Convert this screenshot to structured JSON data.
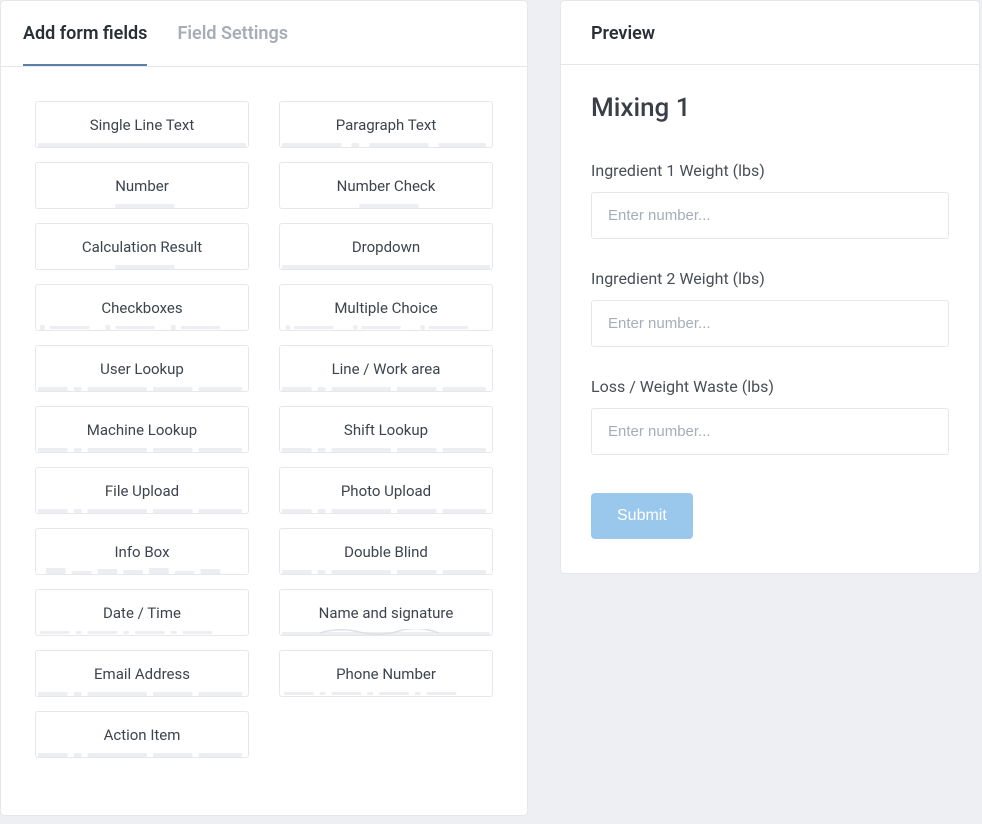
{
  "tabs": {
    "add_fields": "Add form fields",
    "field_settings": "Field Settings"
  },
  "fields": {
    "single_line_text": "Single Line Text",
    "paragraph_text": "Paragraph Text",
    "number": "Number",
    "number_check": "Number Check",
    "calculation_result": "Calculation Result",
    "dropdown": "Dropdown",
    "checkboxes": "Checkboxes",
    "multiple_choice": "Multiple Choice",
    "user_lookup": "User Lookup",
    "line_work_area": "Line / Work area",
    "machine_lookup": "Machine Lookup",
    "shift_lookup": "Shift Lookup",
    "file_upload": "File Upload",
    "photo_upload": "Photo Upload",
    "info_box": "Info Box",
    "double_blind": "Double Blind",
    "date_time": "Date / Time",
    "name_signature": "Name and signature",
    "email_address": "Email Address",
    "phone_number": "Phone Number",
    "action_item": "Action Item"
  },
  "preview": {
    "header": "Preview",
    "title": "Mixing 1",
    "field1": {
      "label": "Ingredient 1 Weight (lbs)",
      "placeholder": "Enter number..."
    },
    "field2": {
      "label": "Ingredient 2 Weight (lbs)",
      "placeholder": "Enter number..."
    },
    "field3": {
      "label": "Loss / Weight Waste (lbs)",
      "placeholder": "Enter number..."
    },
    "submit": "Submit"
  }
}
